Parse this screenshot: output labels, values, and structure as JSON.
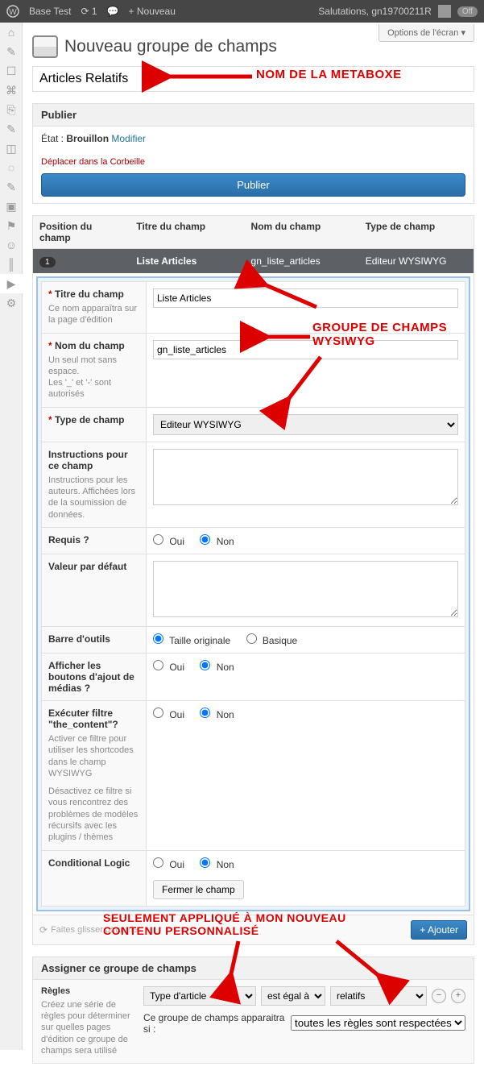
{
  "adminbar": {
    "site_name": "Base Test",
    "refresh_count": "1",
    "new_label": "Nouveau",
    "salutation": "Salutations, gn19700211R",
    "off": "Off"
  },
  "screen_options": "Options de l'écran",
  "page_title": "Nouveau groupe de champs",
  "title_value": "Articles Relatifs",
  "publish": {
    "heading": "Publier",
    "status_label": "État :",
    "status_value": "Brouillon",
    "modify": "Modifier",
    "trash": "Déplacer dans la Corbeille",
    "button": "Publier"
  },
  "fields_head": {
    "pos": "Position du champ",
    "title": "Titre du champ",
    "name": "Nom du champ",
    "type": "Type de champ"
  },
  "field_row": {
    "order": "1",
    "title": "Liste Articles",
    "name": "gn_liste_articles",
    "type": "Editeur WYSIWYG"
  },
  "editor": {
    "titre_lbl": "Titre du champ",
    "titre_help": "Ce nom apparaîtra sur la page d'édition",
    "titre_val": "Liste Articles",
    "nom_lbl": "Nom du champ",
    "nom_help": "Un seul mot sans espace.\nLes '_' et '-' sont autorisés",
    "nom_val": "gn_liste_articles",
    "type_lbl": "Type de champ",
    "type_val": "Editeur WYSIWYG",
    "instr_lbl": "Instructions pour ce champ",
    "instr_help": "Instructions pour les auteurs. Affichées lors de la soumission de données.",
    "requis_lbl": "Requis ?",
    "oui": "Oui",
    "non": "Non",
    "defaut_lbl": "Valeur par défaut",
    "toolbar_lbl": "Barre d'outils",
    "toolbar_full": "Taille originale",
    "toolbar_basic": "Basique",
    "media_lbl": "Afficher les boutons d'ajout de médias ?",
    "filter_lbl": "Exécuter filtre \"the_content\"?",
    "filter_help1": "Activer ce filtre pour utiliser les shortcodes dans le champ WYSIWYG",
    "filter_help2": "Désactivez ce filtre si vous rencontrez des problèmes de modèles récursifs avec les plugins / thèmes",
    "cond_lbl": "Conditional Logic",
    "close": "Fermer le champ"
  },
  "actions": {
    "hint": "Faites glisser pour trier",
    "add": "+ Ajouter"
  },
  "assign": {
    "heading": "Assigner ce groupe de champs",
    "rules_lbl": "Règles",
    "rules_help": "Créez une série de règles pour déterminer sur quelles pages d'édition ce groupe de champs sera utilisé",
    "rule_param": "Type d'article",
    "rule_op": "est égal à",
    "rule_val": "relatifs",
    "appear_label": "Ce groupe de champs apparaitra si :",
    "appear_val": "toutes les règles sont respectées"
  },
  "annotations": {
    "a1": "NOM DE LA METABOXE",
    "a2": "GROUPE DE CHAMPS\nWYSIWYG",
    "a3": "SEULEMENT APPLIQUÉ À MON NOUVEAU\nCONTENU PERSONNALISÉ"
  }
}
